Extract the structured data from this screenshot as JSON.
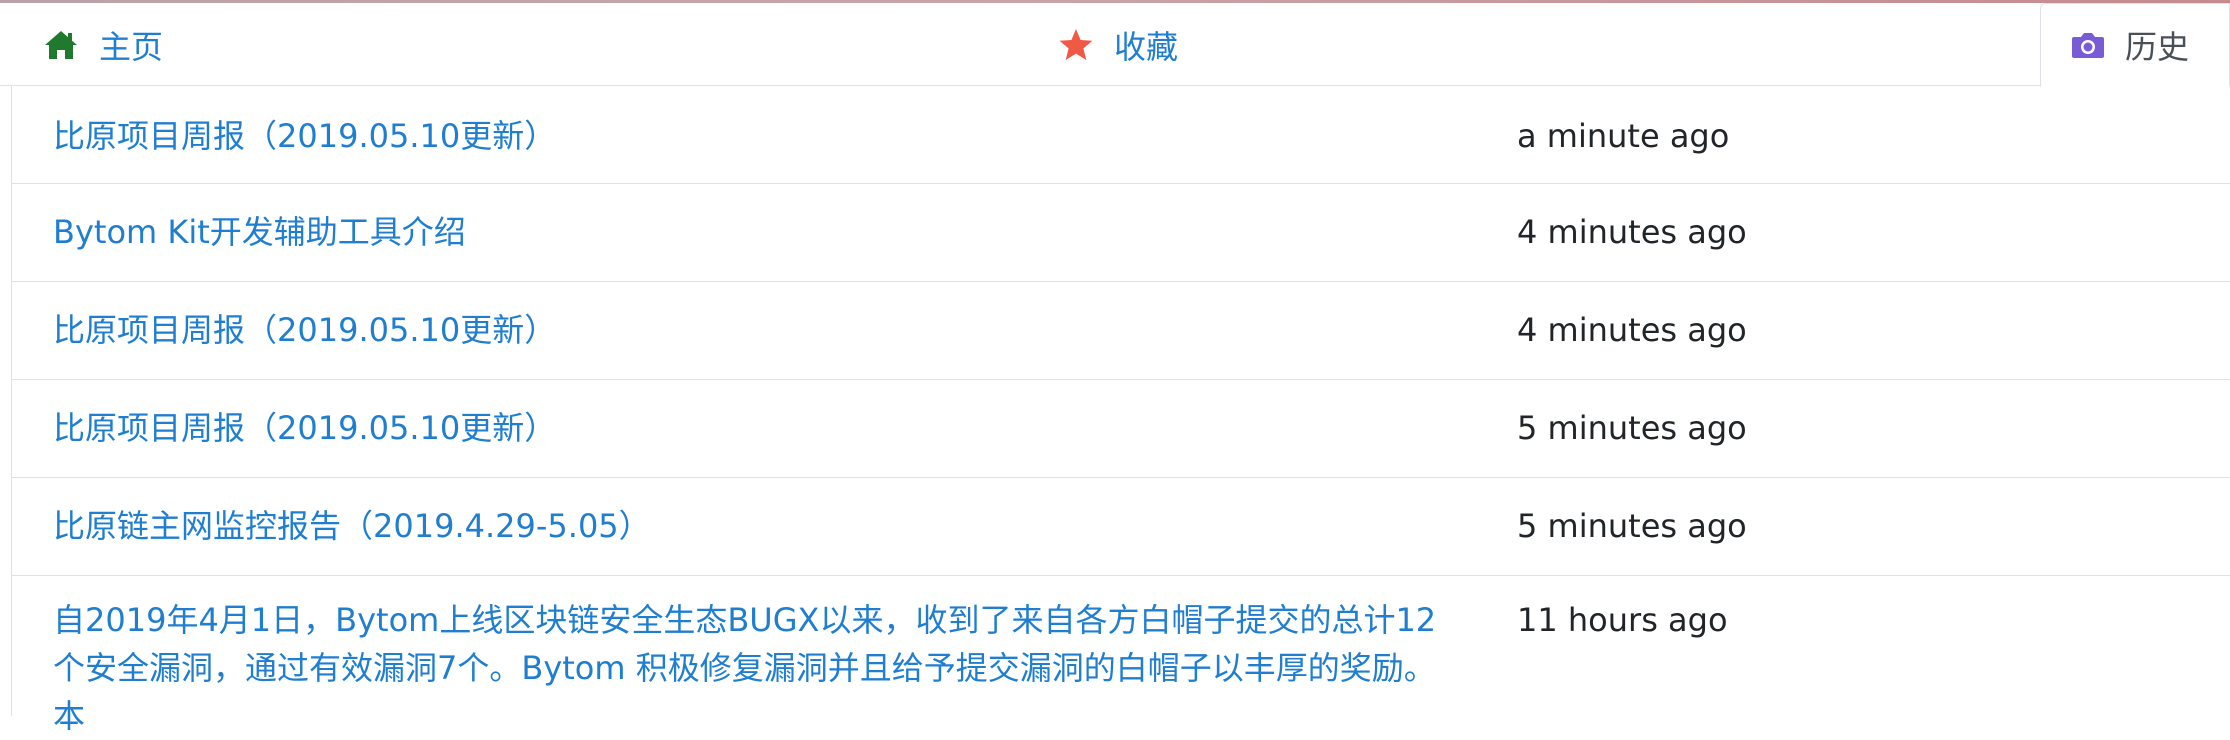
{
  "tabs": {
    "home": {
      "label": "主页",
      "icon": "home-icon",
      "color": "#1f7a2e"
    },
    "favorites": {
      "label": "收藏",
      "icon": "star-icon",
      "color": "#f05a45"
    },
    "history": {
      "label": "历史",
      "icon": "camera-icon",
      "color": "#7a5bd6",
      "active": true
    }
  },
  "colors": {
    "link": "#1f7ed0",
    "text": "#212529",
    "border": "#dee2e6"
  },
  "history": {
    "items": [
      {
        "title": "比原项目周报（2019.05.10更新）",
        "time": "a minute ago"
      },
      {
        "title": "Bytom Kit开发辅助工具介绍",
        "time": "4 minutes ago"
      },
      {
        "title": "比原项目周报（2019.05.10更新）",
        "time": "4 minutes ago"
      },
      {
        "title": "比原项目周报（2019.05.10更新）",
        "time": "5 minutes ago"
      },
      {
        "title": "比原链主网监控报告（2019.4.29-5.05）",
        "time": "5 minutes ago"
      },
      {
        "title": "自2019年4月1日，Bytom上线区块链安全生态BUGX以来，收到了来自各方白帽子提交的总计12个安全漏洞，通过有效漏洞7个。Bytom 积极修复漏洞并且给予提交漏洞的白帽子以丰厚的奖励。本",
        "time": "11 hours ago"
      }
    ]
  }
}
